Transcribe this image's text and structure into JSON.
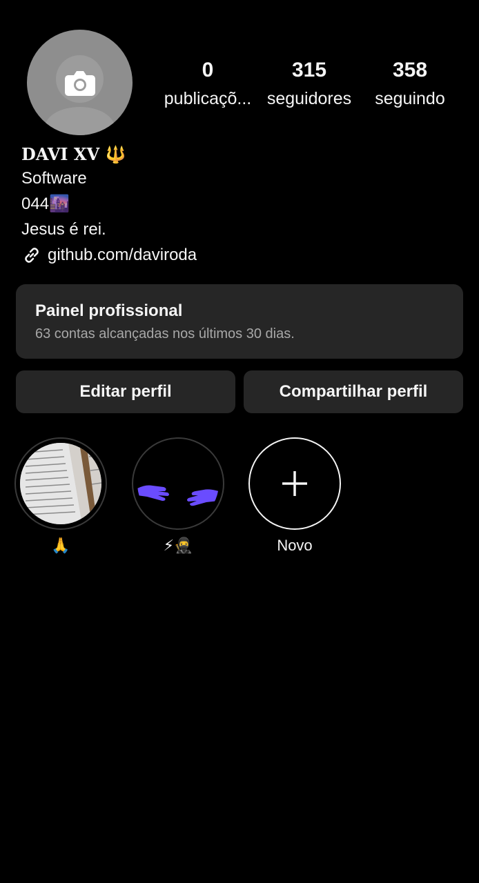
{
  "profile": {
    "avatar_icon": "camera-icon",
    "name": "DAVI XV 🔱",
    "bio_lines": [
      "Software",
      "044🌆",
      "Jesus é rei."
    ],
    "link_text": "github.com/daviroda"
  },
  "stats": {
    "posts": {
      "value": "0",
      "label": "publicaçõ..."
    },
    "followers": {
      "value": "315",
      "label": "seguidores"
    },
    "following": {
      "value": "358",
      "label": "seguindo"
    }
  },
  "panel": {
    "title": "Painel profissional",
    "subtitle": "63 contas alcançadas nos últimos 30 dias."
  },
  "buttons": {
    "edit": "Editar perfil",
    "share": "Compartilhar perfil"
  },
  "highlights": [
    {
      "caption": "🙏"
    },
    {
      "caption": "⚡🥷"
    },
    {
      "caption": "Novo"
    }
  ],
  "colors": {
    "background": "#000000",
    "card": "#262626",
    "text": "#f5f5f5",
    "muted": "#a8a8a8",
    "accent": "#6a4cff"
  }
}
